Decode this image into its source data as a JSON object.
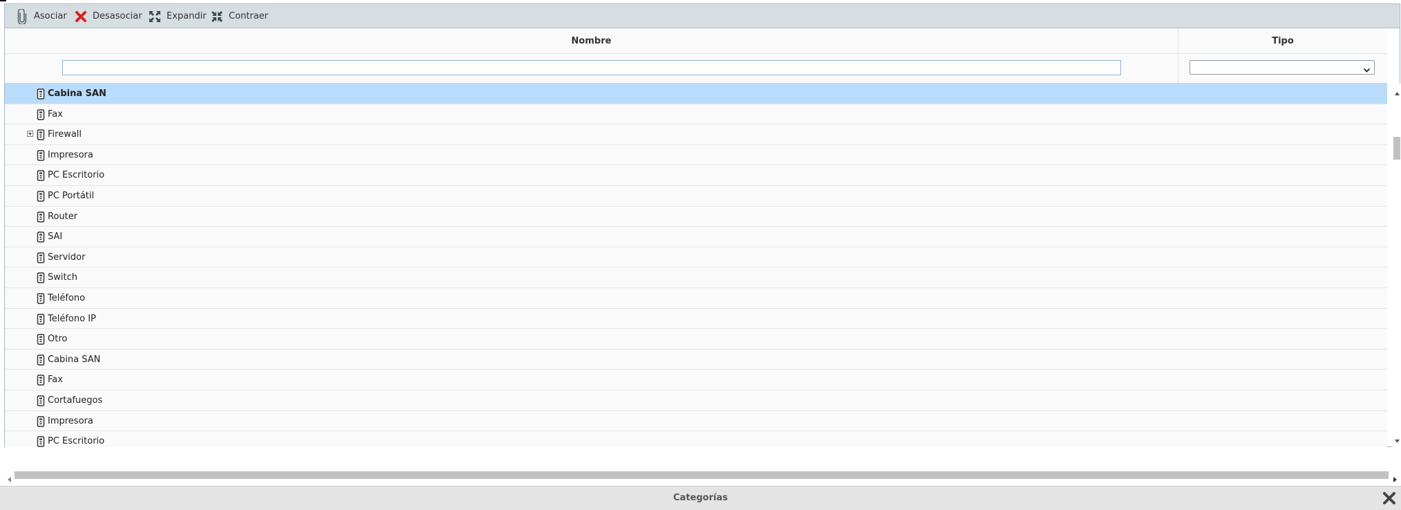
{
  "toolbar": {
    "asociar_label": "Asociar",
    "asociar_icon": "paperclip-icon",
    "desasociar_label": "Desasociar",
    "desasociar_icon": "red-x-icon",
    "expandir_label": "Expandir",
    "expandir_icon": "expand-icon",
    "contraer_label": "Contraer",
    "contraer_icon": "collapse-icon"
  },
  "grid": {
    "columns": [
      "Nombre",
      "Tipo"
    ],
    "filter": {
      "nombre_value": "",
      "tipo_selected": ""
    },
    "rows": [
      {
        "name": "Cabina SAN",
        "selected": true,
        "expandable": false
      },
      {
        "name": "Fax",
        "selected": false,
        "expandable": false
      },
      {
        "name": "Firewall",
        "selected": false,
        "expandable": true
      },
      {
        "name": "Impresora",
        "selected": false,
        "expandable": false
      },
      {
        "name": "PC Escritorio",
        "selected": false,
        "expandable": false
      },
      {
        "name": "PC Portátil",
        "selected": false,
        "expandable": false
      },
      {
        "name": "Router",
        "selected": false,
        "expandable": false
      },
      {
        "name": "SAI",
        "selected": false,
        "expandable": false
      },
      {
        "name": "Servidor",
        "selected": false,
        "expandable": false
      },
      {
        "name": "Switch",
        "selected": false,
        "expandable": false
      },
      {
        "name": "Teléfono",
        "selected": false,
        "expandable": false
      },
      {
        "name": "Teléfono IP",
        "selected": false,
        "expandable": false
      },
      {
        "name": "Otro",
        "selected": false,
        "expandable": false
      },
      {
        "name": "Cabina SAN",
        "selected": false,
        "expandable": false
      },
      {
        "name": "Fax",
        "selected": false,
        "expandable": false
      },
      {
        "name": "Cortafuegos",
        "selected": false,
        "expandable": false
      },
      {
        "name": "Impresora",
        "selected": false,
        "expandable": false
      },
      {
        "name": "PC Escritorio",
        "selected": false,
        "expandable": false
      }
    ]
  },
  "footer": {
    "title": "Categorías",
    "close_icon": "close-icon"
  },
  "colors": {
    "selected_row": "#b9dcfb",
    "toolbar_bg": "#d6dee2",
    "delete_red": "#e0201b"
  }
}
